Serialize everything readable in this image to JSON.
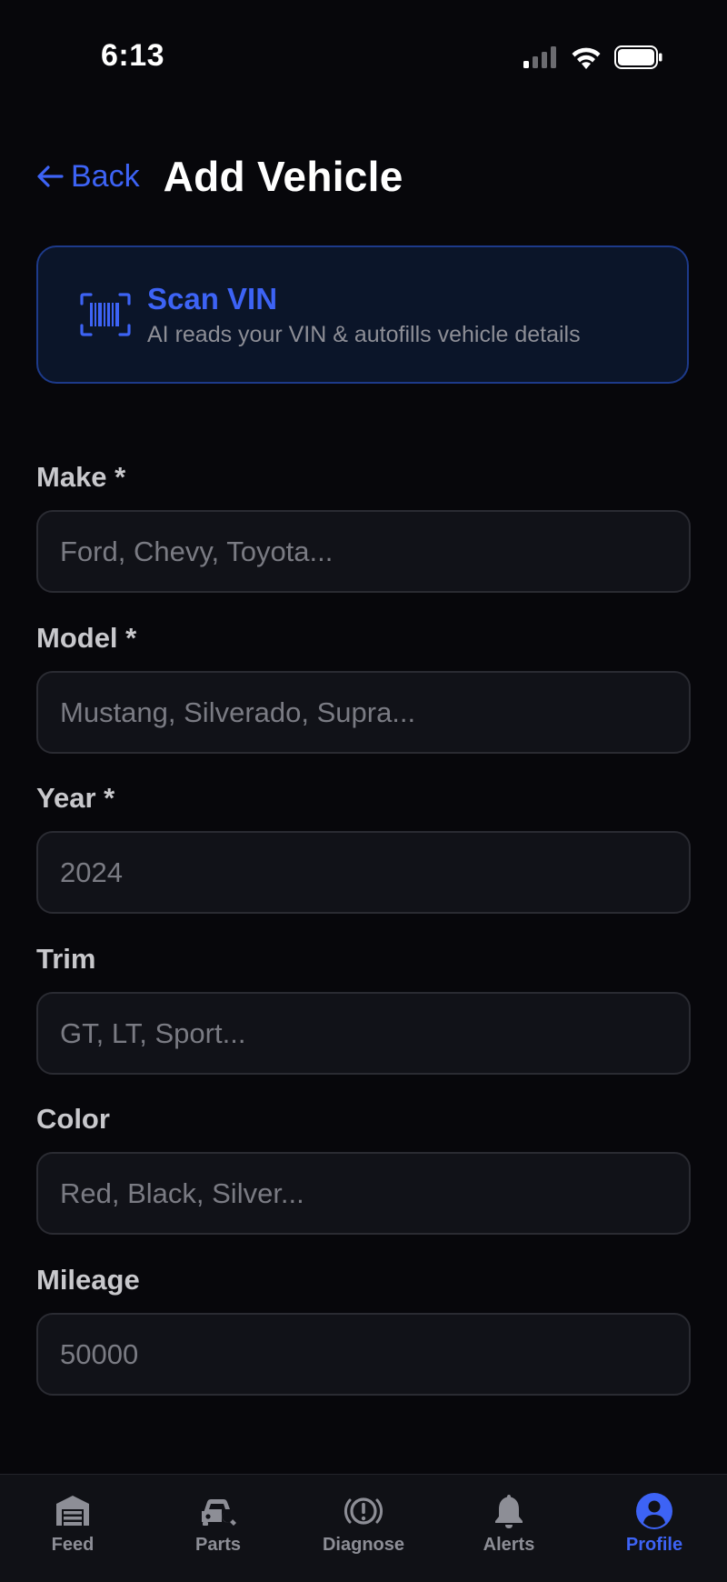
{
  "status_bar": {
    "time": "6:13"
  },
  "header": {
    "back_label": "Back",
    "title": "Add Vehicle"
  },
  "scan_vin": {
    "title": "Scan VIN",
    "subtitle": "AI reads your VIN & autofills vehicle details",
    "icon": "barcode-scan-icon"
  },
  "form": {
    "make": {
      "label": "Make *",
      "placeholder": "Ford, Chevy, Toyota...",
      "value": ""
    },
    "model": {
      "label": "Model *",
      "placeholder": "Mustang, Silverado, Supra...",
      "value": ""
    },
    "year": {
      "label": "Year *",
      "placeholder": "2024",
      "value": ""
    },
    "trim": {
      "label": "Trim",
      "placeholder": "GT, LT, Sport...",
      "value": ""
    },
    "color": {
      "label": "Color",
      "placeholder": "Red, Black, Silver...",
      "value": ""
    },
    "mileage": {
      "label": "Mileage",
      "placeholder": "50000",
      "value": ""
    }
  },
  "tab_bar": {
    "tabs": [
      {
        "label": "Feed",
        "icon": "garage-icon",
        "active": false
      },
      {
        "label": "Parts",
        "icon": "car-wrench-icon",
        "active": false
      },
      {
        "label": "Diagnose",
        "icon": "warning-circle-icon",
        "active": false
      },
      {
        "label": "Alerts",
        "icon": "bell-icon",
        "active": false
      },
      {
        "label": "Profile",
        "icon": "profile-icon",
        "active": true
      }
    ]
  },
  "colors": {
    "background": "#07070b",
    "accent": "#3d63f5",
    "card_background": "#0b1529",
    "input_background": "#111218",
    "muted_text": "#8d8e96"
  }
}
